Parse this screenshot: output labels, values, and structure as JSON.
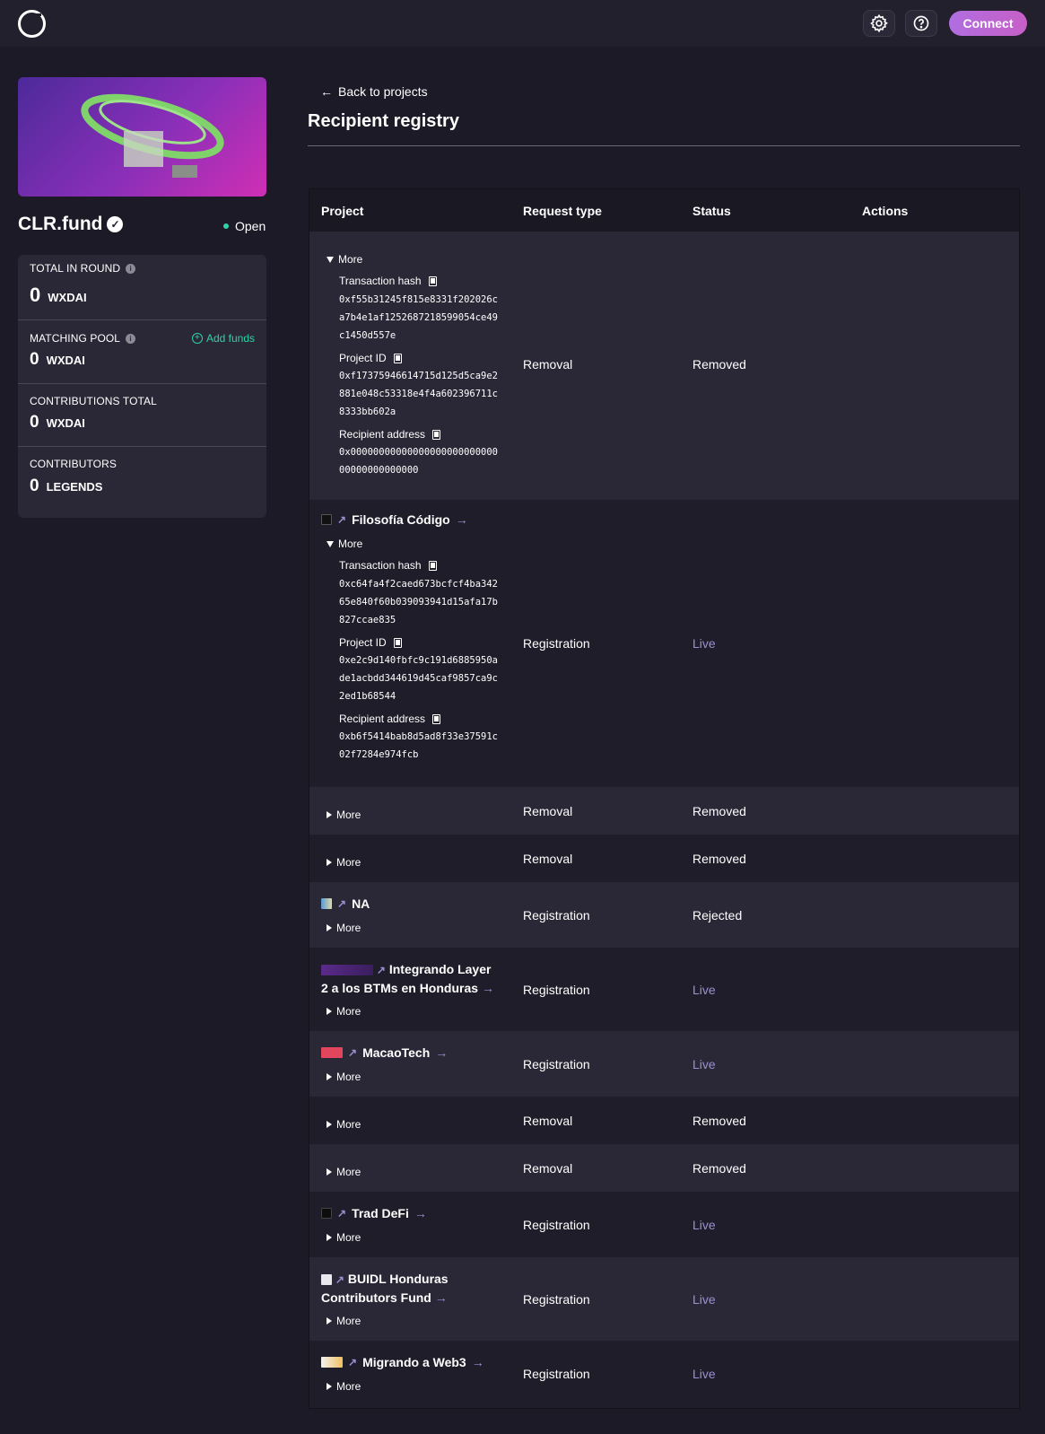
{
  "header": {
    "logo_icon": "ring-logo-icon",
    "settings_icon": "gear-icon",
    "help_icon": "question-icon",
    "connect_label": "Connect"
  },
  "sidebar": {
    "project_name": "CLR.fund",
    "status": "Open",
    "stats": [
      {
        "label": "TOTAL IN ROUND",
        "value": "0",
        "unit": "WXDAI"
      },
      {
        "label": "MATCHING POOL",
        "value": "0",
        "unit": "WXDAI",
        "action": "Add funds"
      },
      {
        "label": "CONTRIBUTIONS TOTAL",
        "value": "0",
        "unit": "WXDAI"
      },
      {
        "label": "CONTRIBUTORS",
        "value": "0",
        "unit": "LEGENDS"
      }
    ]
  },
  "main": {
    "back_label": "Back to projects",
    "title": "Recipient registry",
    "columns": [
      "Project",
      "Request type",
      "Status",
      "Actions"
    ],
    "more_label": "More",
    "labels": {
      "tx": "Transaction hash",
      "pid": "Project ID",
      "addr": "Recipient address"
    },
    "rows": [
      {
        "project": "",
        "type": "Removal",
        "status": "Removed",
        "expanded": true,
        "tx": "0xf55b31245f815e8331f202026ca7b4e1af1252687218599054ce49c1450d557e",
        "pid": "0xf17375946614715d125d5ca9e2881e048c53318e4f4a602396711c8333bb602a",
        "addr": "0x0000000000000000000000000000000000000000"
      },
      {
        "project": "Filosofía Código",
        "type": "Registration",
        "status": "Live",
        "expanded": true,
        "tx": "0xc64fa4f2caed673bcfcf4ba34265e840f60b039093941d15afa17b827ccae835",
        "pid": "0xe2c9d140fbfc9c191d6885950ade1acbdd344619d45caf9857ca9c2ed1b68544",
        "addr": "0xb6f5414bab8d5ad8f33e37591c02f7284e974fcb"
      },
      {
        "project": "",
        "type": "Removal",
        "status": "Removed"
      },
      {
        "project": "",
        "type": "Removal",
        "status": "Removed"
      },
      {
        "project": "NA",
        "type": "Registration",
        "status": "Rejected"
      },
      {
        "project": "Integrando Layer 2 a los BTMs en Honduras",
        "type": "Registration",
        "status": "Live"
      },
      {
        "project": "MacaoTech",
        "type": "Registration",
        "status": "Live"
      },
      {
        "project": "",
        "type": "Removal",
        "status": "Removed"
      },
      {
        "project": "",
        "type": "Removal",
        "status": "Removed"
      },
      {
        "project": "Trad DeFi",
        "type": "Registration",
        "status": "Live"
      },
      {
        "project": "BUIDL Honduras Contributors Fund",
        "type": "Registration",
        "status": "Live"
      },
      {
        "project": "Migrando a Web3",
        "type": "Registration",
        "status": "Live"
      }
    ]
  },
  "colors": {
    "accent": "#9b8fd3",
    "success": "#2ed3a6",
    "connect_gradient_start": "#b06ee0",
    "connect_gradient_end": "#c75fc7"
  }
}
